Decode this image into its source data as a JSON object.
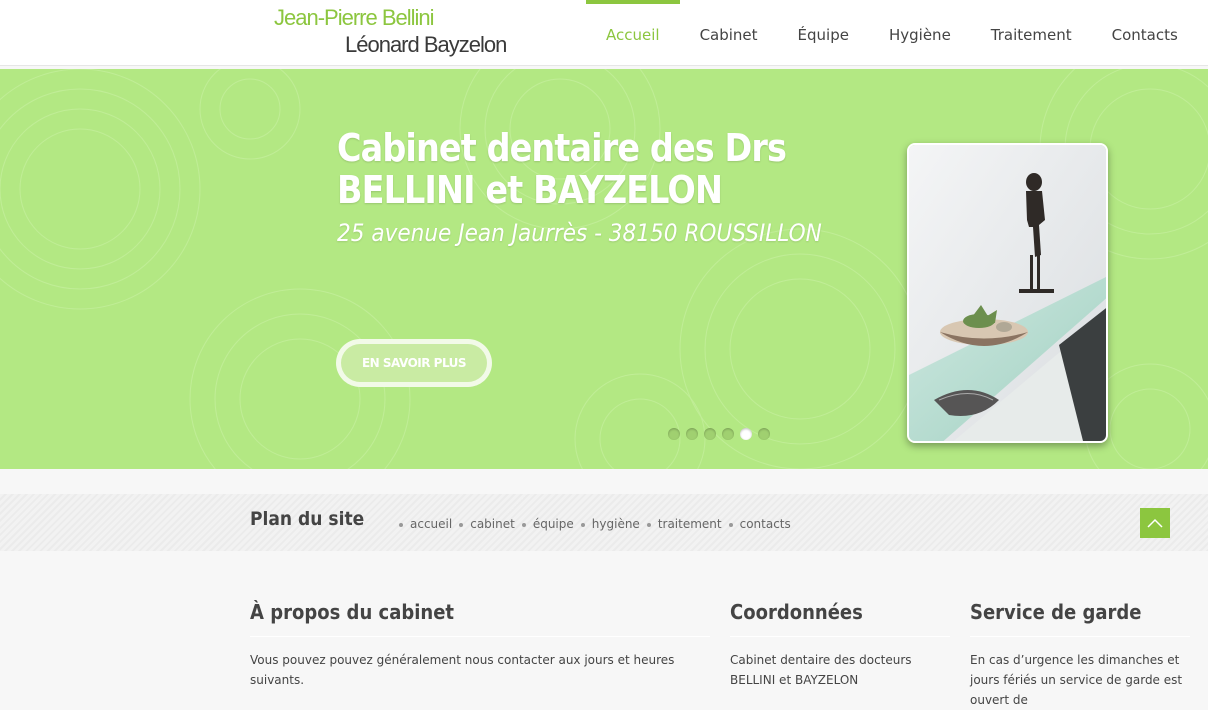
{
  "header": {
    "logo_line1": "Jean-Pierre Bellini",
    "logo_line2": "Léonard Bayzelon",
    "nav": [
      "Accueil",
      "Cabinet",
      "Équipe",
      "Hygiène",
      "Traitement",
      "Contacts"
    ],
    "active_nav": "Accueil"
  },
  "hero": {
    "title": "Cabinet dentaire des Drs BELLINI et BAYZELON",
    "subtitle": "25 avenue Jean Jaurrès - 38150 ROUSSILLON",
    "button": "EN SAVOIR PLUS",
    "slides": 6,
    "active_slide": 5
  },
  "sitemap": {
    "title": "Plan du site",
    "links": [
      "accueil",
      "cabinet",
      "équipe",
      "hygiène",
      "traitement",
      "contacts"
    ]
  },
  "sections": {
    "about": {
      "title": "À propos du cabinet",
      "text": "Vous pouvez pouvez généralement nous contacter aux jours et heures suivants."
    },
    "contact": {
      "title": "Coordonnées",
      "text": "Cabinet dentaire des docteurs BELLINI et BAYZELON"
    },
    "guard": {
      "title": "Service de garde",
      "text": "En cas d’urgence les dimanches et jours fériés un service de garde est ouvert de"
    }
  },
  "colors": {
    "accent": "#8cc63f",
    "hero_bg": "#b3e883"
  },
  "icons": [
    "arrow-up-icon"
  ]
}
